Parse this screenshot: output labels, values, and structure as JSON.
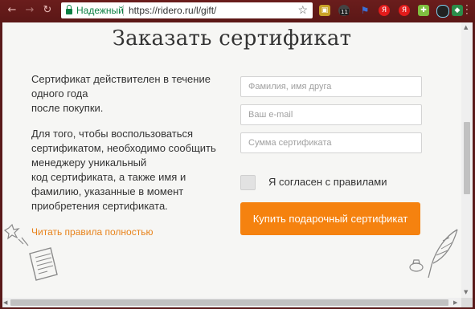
{
  "browser": {
    "secure_label": "Надежный",
    "url": "https://ridero.ru/l/gift/",
    "extensions": [
      {
        "icon": "lock-extension-icon",
        "badge": ""
      },
      {
        "icon": "camera-extension-icon",
        "badge": "11"
      },
      {
        "icon": "flag-extension-icon",
        "badge": ""
      },
      {
        "icon": "yandex-extension-icon",
        "badge": "Я"
      },
      {
        "icon": "yandex-extension-icon",
        "badge": "Я"
      },
      {
        "icon": "puzzle-extension-icon",
        "badge": ""
      },
      {
        "icon": "circle-extension-icon",
        "badge": ""
      },
      {
        "icon": "shield-extension-icon",
        "badge": ""
      }
    ]
  },
  "page": {
    "title": "Заказать сертификат",
    "para1": [
      "Сертификат действителен в течение",
      "одного года",
      "после покупки."
    ],
    "para2": [
      "Для того, чтобы воспользоваться",
      "сертификатом, необходимо сообщить",
      "менеджеру уникальный",
      "код сертификата, а также имя и",
      "фамилию, указанные в момент",
      "приобретения сертификата."
    ],
    "rules_link": "Читать правила полностью",
    "form": {
      "friend_name_placeholder": "Фамилия, имя друга",
      "email_placeholder": "Ваш e-mail",
      "amount_placeholder": "Сумма сертификата",
      "agree_label": "Я согласен с правилами",
      "submit_label": "Купить подарочный сертификат"
    }
  },
  "colors": {
    "chrome": "#5b1716",
    "accent": "#f5820f",
    "link": "#e8831b",
    "secure": "#0b8043"
  }
}
